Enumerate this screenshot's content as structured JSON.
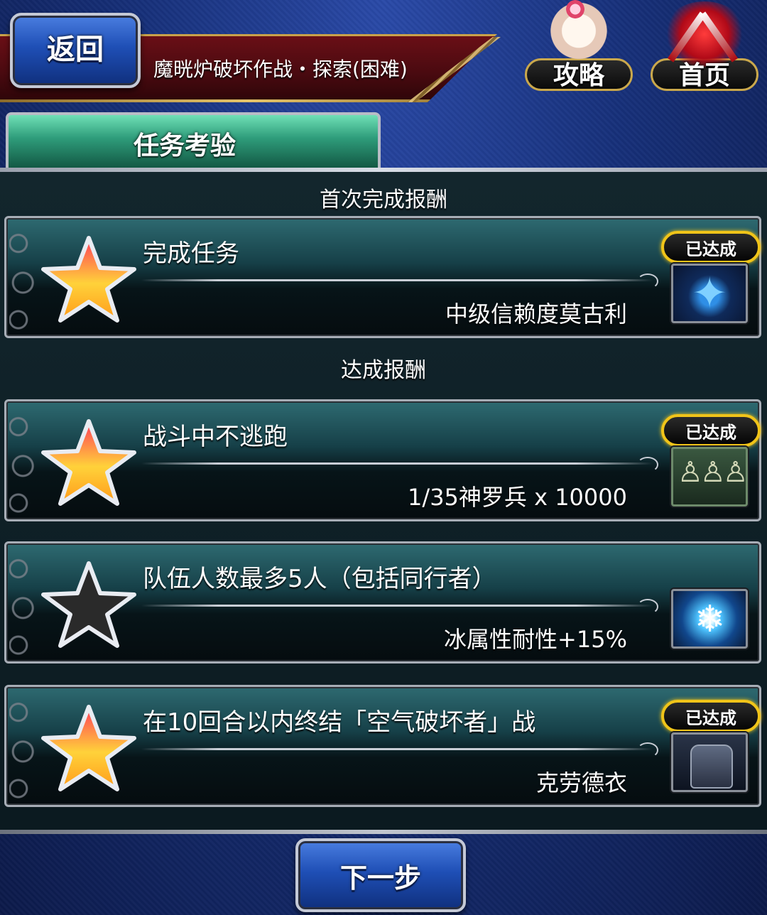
{
  "header": {
    "back_label": "返回",
    "quest_title": "魔晄炉破坏作战・探索(困难)",
    "guide_label": "攻略",
    "home_label": "首页"
  },
  "tab": {
    "label": "任务考验"
  },
  "sections": {
    "first_clear_heading": "首次完成报酬",
    "achievement_heading": "达成报酬"
  },
  "missions": [
    {
      "text": "完成任务",
      "reward": "中级信赖度莫古利",
      "achieved": true,
      "badge": "已达成",
      "star": "gold",
      "item_icon": "moogle-compass-icon"
    },
    {
      "text": "战斗中不逃跑",
      "reward": "1/35神罗兵 x 10000",
      "achieved": true,
      "badge": "已达成",
      "star": "gold",
      "item_icon": "shinra-figure-icon"
    },
    {
      "text": "队伍人数最多5人（包括同行者）",
      "reward": "冰属性耐性+15%",
      "achieved": false,
      "badge": "",
      "star": "gray",
      "item_icon": "ice-resist-icon"
    },
    {
      "text": "在10回合以内终结「空气破坏者」战",
      "reward": "克劳德衣",
      "achieved": true,
      "badge": "已达成",
      "star": "gold",
      "item_icon": "cloud-outfit-icon"
    }
  ],
  "footer": {
    "next_label": "下一步"
  },
  "colors": {
    "badge_border": "#f0c419",
    "star_gold": "#ffd23a",
    "star_gray": "#2a2a2a",
    "button_blue": "#1f4fb6",
    "tab_green": "#2f9d7b",
    "banner_red": "#6a0f16"
  }
}
